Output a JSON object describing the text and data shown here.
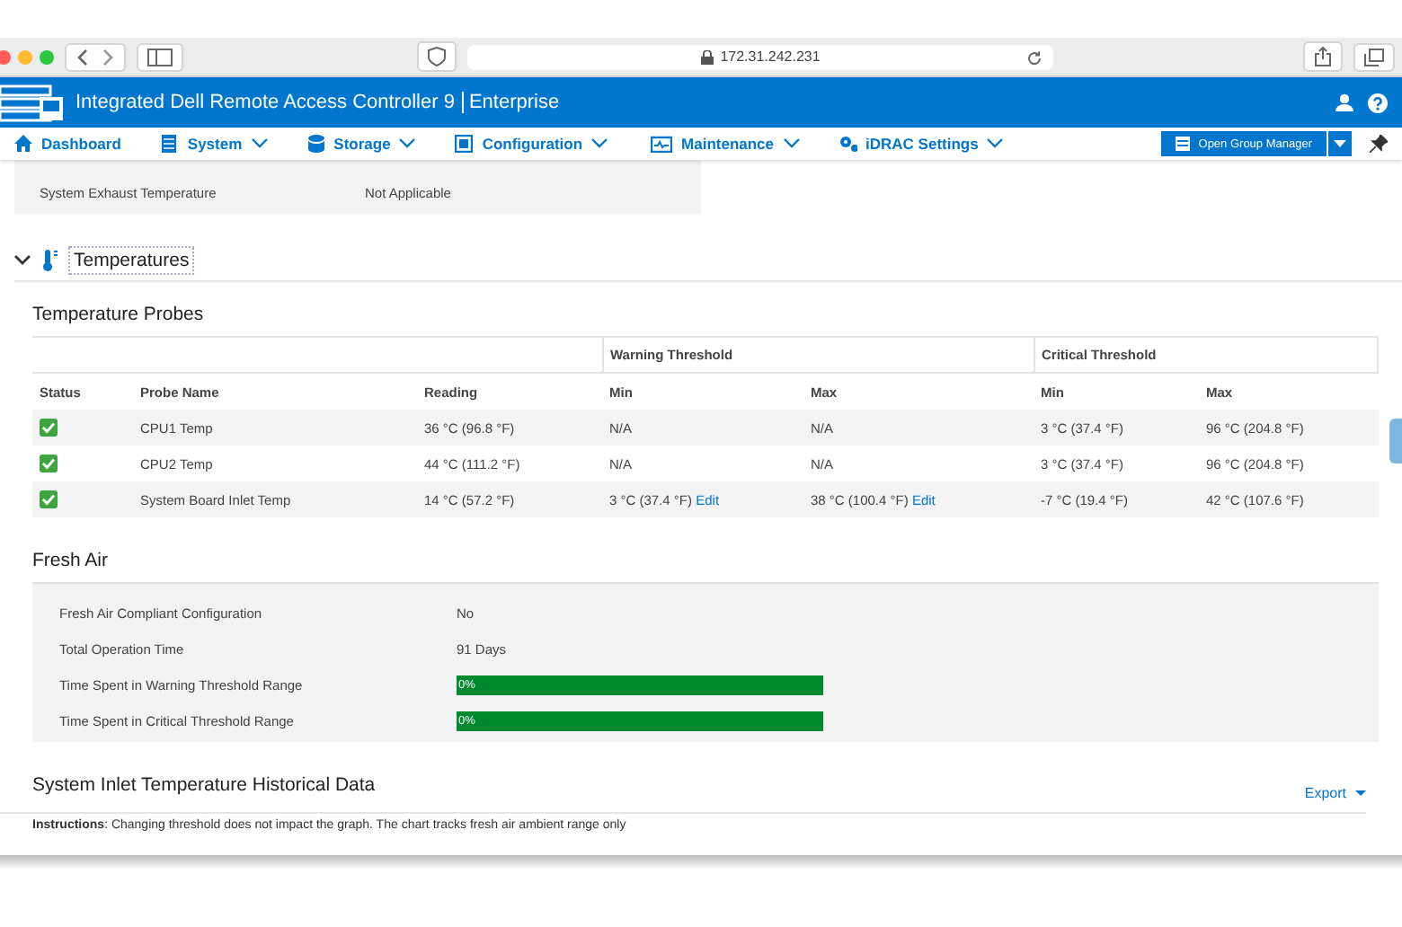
{
  "browser": {
    "address": "172.31.242.231"
  },
  "header": {
    "title": "Integrated Dell Remote Access Controller 9",
    "edition": "Enterprise"
  },
  "nav": {
    "items": [
      {
        "label": "Dashboard",
        "dropdown": false
      },
      {
        "label": "System",
        "dropdown": true
      },
      {
        "label": "Storage",
        "dropdown": true
      },
      {
        "label": "Configuration",
        "dropdown": true
      },
      {
        "label": "Maintenance",
        "dropdown": true
      },
      {
        "label": "iDRAC Settings",
        "dropdown": true
      }
    ],
    "group_button": "Open Group Manager"
  },
  "summary_rows": [
    {
      "label": "System Exhaust Temperature",
      "value": "Not Applicable"
    }
  ],
  "section": {
    "title": "Temperatures",
    "expanded": true
  },
  "probes": {
    "title": "Temperature Probes",
    "group_headers": [
      "Warning Threshold",
      "Critical Threshold"
    ],
    "columns": [
      "Status",
      "Probe Name",
      "Reading",
      "Min",
      "Max",
      "Min",
      "Max"
    ],
    "rows": [
      {
        "name": "CPU1 Temp",
        "reading": "36 °C (96.8 °F)",
        "warn_min": "N/A",
        "warn_max": "N/A",
        "crit_min": "3 °C (37.4 °F)",
        "crit_max": "96 °C (204.8 °F)"
      },
      {
        "name": "CPU2 Temp",
        "reading": "44 °C (111.2 °F)",
        "warn_min": "N/A",
        "warn_max": "N/A",
        "crit_min": "3 °C (37.4 °F)",
        "crit_max": "96 °C (204.8 °F)"
      },
      {
        "name": "System Board Inlet Temp",
        "reading": "14 °C (57.2 °F)",
        "warn_min": "3 °C (37.4 °F)",
        "warn_max": "38 °C (100.4 °F)",
        "crit_min": "-7 °C (19.4 °F)",
        "crit_max": "42 °C (107.6 °F)",
        "edit_links": [
          "Edit",
          "Edit"
        ]
      }
    ]
  },
  "fresh_air": {
    "title": "Fresh Air",
    "rows": [
      {
        "kind": "text",
        "label": "Fresh Air Compliant Configuration",
        "value": "No"
      },
      {
        "kind": "text",
        "label": "Total Operation Time",
        "value": "91 Days"
      },
      {
        "kind": "bar",
        "label": "Time Spent in Warning Threshold Range",
        "value": "0%",
        "level": 0
      },
      {
        "kind": "bar",
        "label": "Time Spent in Critical Threshold Range",
        "value": "0%",
        "level": 0
      }
    ]
  },
  "history": {
    "title": "System Inlet Temperature Historical Data",
    "export": "Export",
    "instructions": "**Instructions**:  Changing threshold does not impact the graph. The chart tracks fresh air ambient range only"
  }
}
